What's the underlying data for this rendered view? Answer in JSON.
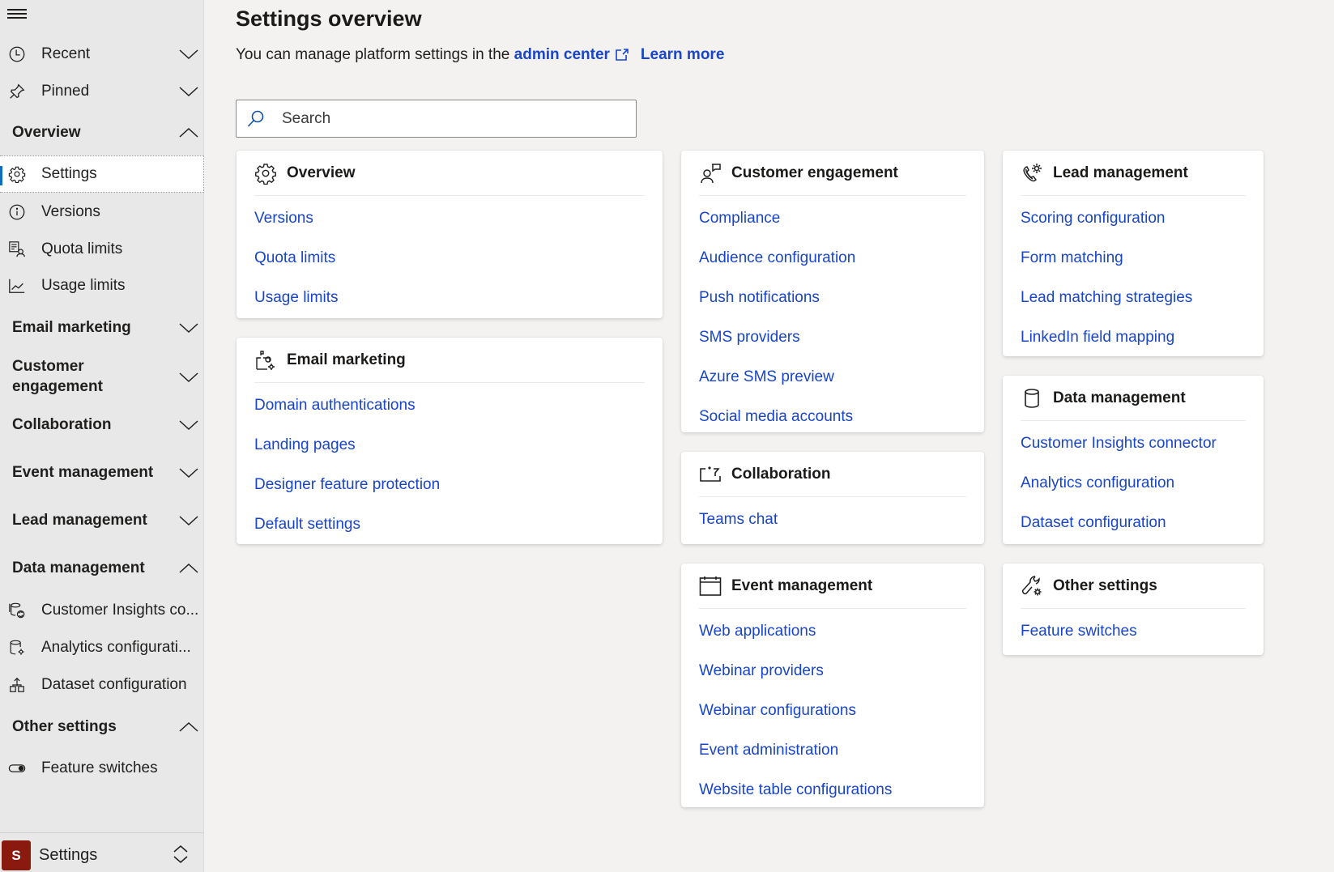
{
  "sidebar": {
    "menu_icon": "hamburger-menu-icon",
    "recent": {
      "label": "Recent",
      "icon": "clock-icon",
      "expanded": false
    },
    "pinned": {
      "label": "Pinned",
      "icon": "pin-icon",
      "expanded": false
    },
    "groups": {
      "overview": {
        "label": "Overview",
        "expanded": true
      },
      "email": {
        "label": "Email marketing",
        "expanded": false
      },
      "customer": {
        "label": "Customer engagement",
        "expanded": false
      },
      "collab": {
        "label": "Collaboration",
        "expanded": false
      },
      "event": {
        "label": "Event management",
        "expanded": false
      },
      "lead": {
        "label": "Lead management",
        "expanded": false
      },
      "data": {
        "label": "Data management",
        "expanded": true
      },
      "other": {
        "label": "Other settings",
        "expanded": true
      }
    },
    "items": {
      "settings": {
        "label": "Settings",
        "icon": "gear-icon",
        "selected": true
      },
      "versions": {
        "label": "Versions",
        "icon": "info-icon"
      },
      "quota": {
        "label": "Quota limits",
        "icon": "quota-list-person-icon"
      },
      "usage": {
        "label": "Usage limits",
        "icon": "line-chart-icon"
      },
      "ci_connector": {
        "label": "Customer Insights co...",
        "icon": "database-sync-icon"
      },
      "analytics": {
        "label": "Analytics configurati...",
        "icon": "database-gear-icon"
      },
      "dataset": {
        "label": "Dataset configuration",
        "icon": "hierarchy-icon"
      },
      "feature_switches": {
        "label": "Feature switches",
        "icon": "toggle-icon"
      }
    },
    "footer": {
      "avatar_letter": "S",
      "avatar_color": "#8b1a0e",
      "label": "Settings"
    }
  },
  "main": {
    "title": "Settings overview",
    "subtitle_text": "You can manage platform settings in the",
    "admin_center_link": "admin center",
    "learn_more_link": "Learn more",
    "search": {
      "placeholder": "Search",
      "value": ""
    },
    "cards": {
      "overview": {
        "title": "Overview",
        "icon": "gear-icon",
        "links": [
          "Versions",
          "Quota limits",
          "Usage limits"
        ]
      },
      "email": {
        "title": "Email marketing",
        "icon": "mailbox-gear-icon",
        "links": [
          "Domain authentications",
          "Landing pages",
          "Designer feature protection",
          "Default settings"
        ]
      },
      "customer": {
        "title": "Customer engagement",
        "icon": "person-feedback-icon",
        "links": [
          "Compliance",
          "Audience configuration",
          "Push notifications",
          "SMS providers",
          "Azure SMS preview",
          "Social media accounts"
        ]
      },
      "collab": {
        "title": "Collaboration",
        "icon": "collaboration-edit-icon",
        "links": [
          "Teams chat"
        ]
      },
      "event": {
        "title": "Event management",
        "icon": "calendar-icon",
        "links": [
          "Web applications",
          "Webinar providers",
          "Webinar configurations",
          "Event administration",
          "Website table configurations"
        ]
      },
      "lead": {
        "title": "Lead management",
        "icon": "phone-gear-icon",
        "links": [
          "Scoring configuration",
          "Form matching",
          "Lead matching strategies",
          "LinkedIn field mapping"
        ]
      },
      "data": {
        "title": "Data management",
        "icon": "database-icon",
        "links": [
          "Customer Insights connector",
          "Analytics configuration",
          "Dataset configuration"
        ]
      },
      "other": {
        "title": "Other settings",
        "icon": "wrench-gear-icon",
        "links": [
          "Feature switches"
        ]
      }
    }
  },
  "colors": {
    "link": "#1845c9",
    "sidebar_bg": "#e8e8e8",
    "page_bg": "#f3f2f1",
    "selected_accent": "#0f6cbd"
  }
}
